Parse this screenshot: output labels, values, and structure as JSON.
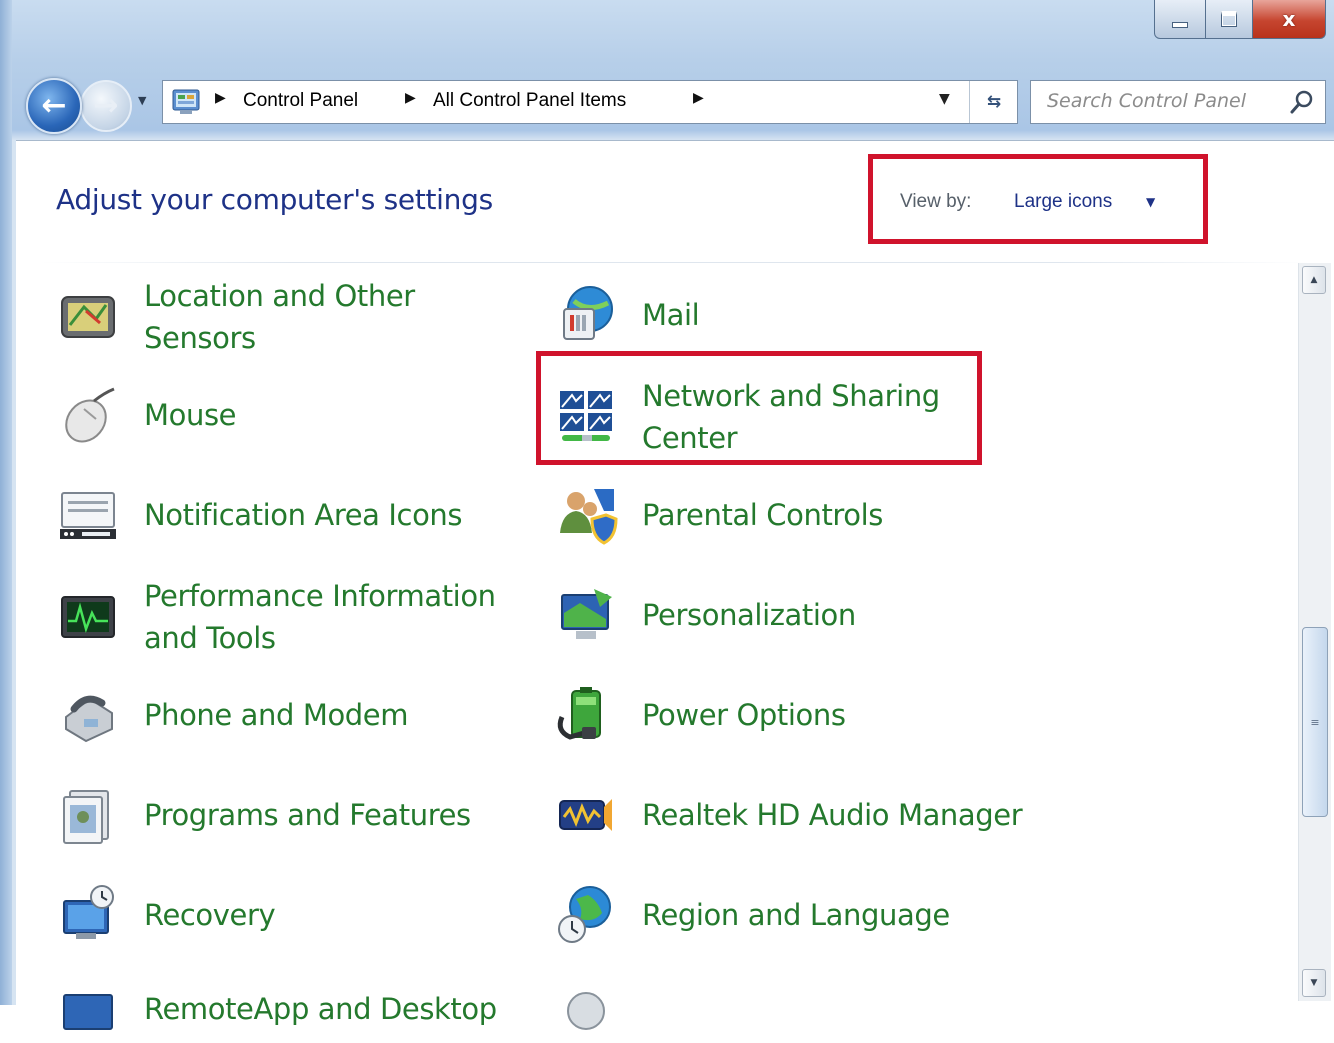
{
  "window": {
    "caption_buttons": {
      "minimize_icon": "minimize-icon",
      "maximize_icon": "maximize-icon",
      "close_icon": "close-icon",
      "close_glyph": "x"
    },
    "nav_icons": {
      "back": "back-arrow-icon",
      "forward": "forward-arrow-icon",
      "recent": "recent-pages-dropdown"
    }
  },
  "address_bar": {
    "breadcrumbs": [
      "Control Panel",
      "All Control Panel Items"
    ],
    "location_icon": "control-panel-icon",
    "refresh_icon": "refresh-icon"
  },
  "search": {
    "placeholder": "Search Control Panel",
    "icon": "search-icon"
  },
  "header": {
    "title": "Adjust your computer's settings",
    "view_by_label": "View by:",
    "view_by_value": "Large icons"
  },
  "items_col1": [
    {
      "label": "Location and Other Sensors",
      "icon": "location-sensors-icon"
    },
    {
      "label": "Mouse",
      "icon": "mouse-icon"
    },
    {
      "label": "Notification Area Icons",
      "icon": "notification-area-icon"
    },
    {
      "label": "Performance Information and Tools",
      "icon": "performance-icon"
    },
    {
      "label": "Phone and Modem",
      "icon": "phone-modem-icon"
    },
    {
      "label": "Programs and Features",
      "icon": "programs-features-icon"
    },
    {
      "label": "Recovery",
      "icon": "recovery-icon"
    },
    {
      "label": "RemoteApp and Desktop",
      "icon": "remoteapp-icon"
    }
  ],
  "items_col2": [
    {
      "label": "Mail",
      "icon": "mail-icon"
    },
    {
      "label": "Network and Sharing Center",
      "icon": "network-sharing-icon"
    },
    {
      "label": "Parental Controls",
      "icon": "parental-controls-icon"
    },
    {
      "label": "Personalization",
      "icon": "personalization-icon"
    },
    {
      "label": "Power Options",
      "icon": "power-options-icon"
    },
    {
      "label": "Realtek HD Audio Manager",
      "icon": "audio-manager-icon"
    },
    {
      "label": "Region and Language",
      "icon": "region-language-icon"
    }
  ],
  "highlight_color": "#d0132c",
  "link_color": "#24792d",
  "title_color": "#1e3287"
}
